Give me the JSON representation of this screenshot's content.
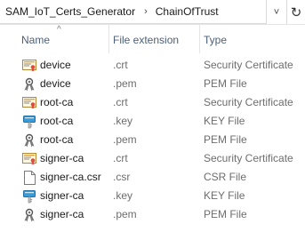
{
  "breadcrumb": {
    "items": [
      "SAM_IoT_Certs_Generator",
      "ChainOfTrust"
    ],
    "separator": "›"
  },
  "address_controls": {
    "dropdown_glyph": "˅",
    "refresh_glyph": "↻"
  },
  "columns": {
    "name": "Name",
    "extension": "File extension",
    "type": "Type",
    "sort_glyph": "^"
  },
  "files": [
    {
      "name": "device",
      "ext": ".crt",
      "type": "Security Certificate",
      "icon": "certificate-icon"
    },
    {
      "name": "device",
      "ext": ".pem",
      "type": "PEM File",
      "icon": "pem-icon"
    },
    {
      "name": "root-ca",
      "ext": ".crt",
      "type": "Security Certificate",
      "icon": "certificate-icon"
    },
    {
      "name": "root-ca",
      "ext": ".key",
      "type": "KEY File",
      "icon": "key-icon"
    },
    {
      "name": "root-ca",
      "ext": ".pem",
      "type": "PEM File",
      "icon": "pem-icon"
    },
    {
      "name": "signer-ca",
      "ext": ".crt",
      "type": "Security Certificate",
      "icon": "certificate-icon"
    },
    {
      "name": "signer-ca.csr",
      "ext": ".csr",
      "type": "CSR File",
      "icon": "file-icon"
    },
    {
      "name": "signer-ca",
      "ext": ".key",
      "type": "KEY File",
      "icon": "key-icon"
    },
    {
      "name": "signer-ca",
      "ext": ".pem",
      "type": "PEM File",
      "icon": "pem-icon"
    }
  ]
}
